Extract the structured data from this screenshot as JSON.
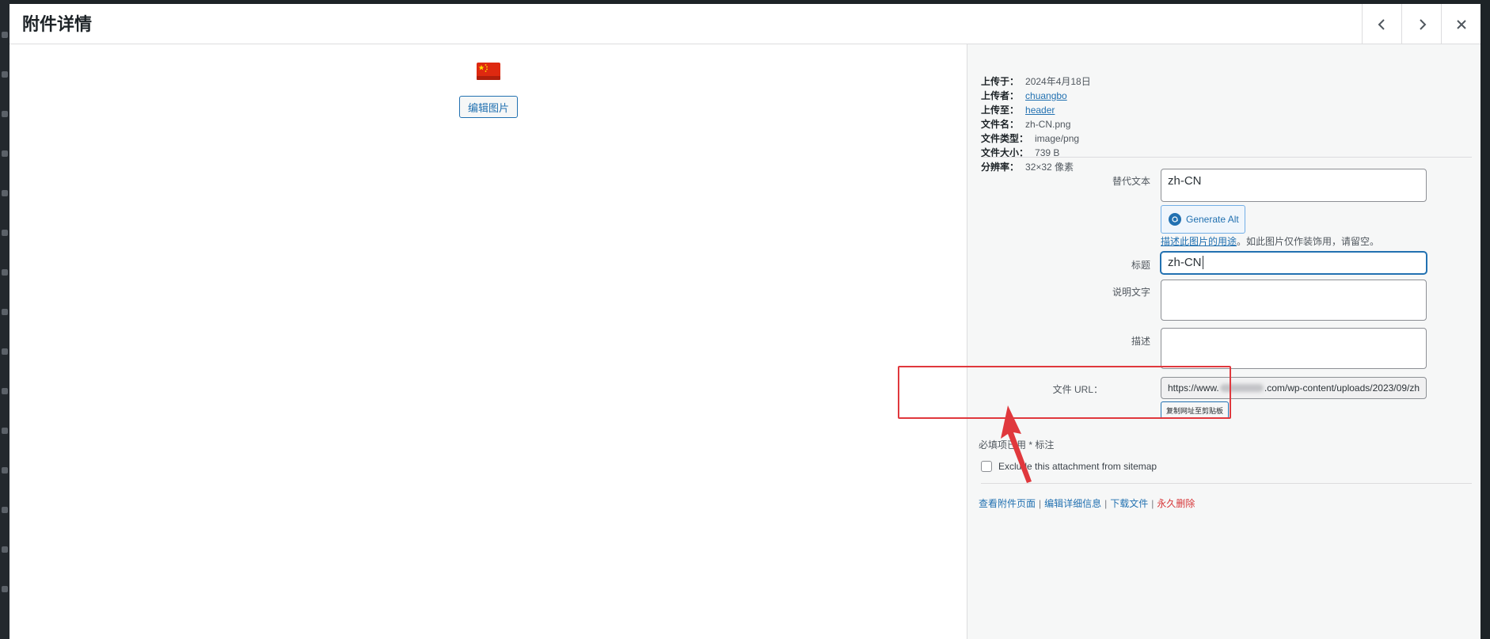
{
  "modal": {
    "title": "附件详情"
  },
  "media": {
    "edit_image_label": "编辑图片"
  },
  "meta": [
    {
      "label": "上传于：",
      "value": "2024年4月18日",
      "link": false
    },
    {
      "label": "上传者：",
      "value": "chuangbo",
      "link": true
    },
    {
      "label": "上传至：",
      "value": "header",
      "link": true
    },
    {
      "label": "文件名：",
      "value": "zh-CN.png",
      "link": false
    },
    {
      "label": "文件类型：",
      "value": "image/png",
      "link": false
    },
    {
      "label": "文件大小：",
      "value": "739 B",
      "link": false
    },
    {
      "label": "分辨率：",
      "value": "32×32 像素",
      "link": false
    }
  ],
  "fields": {
    "alt_label": "替代文本",
    "alt_value": "zh-CN",
    "generate_alt_label": "Generate Alt",
    "alt_help_link": "描述此图片的用途",
    "alt_help_text": "。如此图片仅作装饰用，请留空。",
    "title_label": "标题",
    "title_value": "zh-CN",
    "caption_label": "说明文字",
    "caption_value": "",
    "description_label": "描述",
    "description_value": "",
    "url_label": "文件 URL：",
    "url_prefix": "https://www.",
    "url_suffix": ".com/wp-content/uploads/2023/09/zh",
    "copy_url_label": "复制网址至剪贴板",
    "required_note": "必填项已用 * 标注",
    "sitemap_label": "Exclude this attachment from sitemap"
  },
  "actions": {
    "view_page": "查看附件页面",
    "edit_details": "编辑详细信息",
    "download": "下载文件",
    "delete": "永久删除"
  },
  "colors": {
    "link": "#2271b1",
    "danger": "#d63638",
    "highlight": "#e0383d"
  }
}
